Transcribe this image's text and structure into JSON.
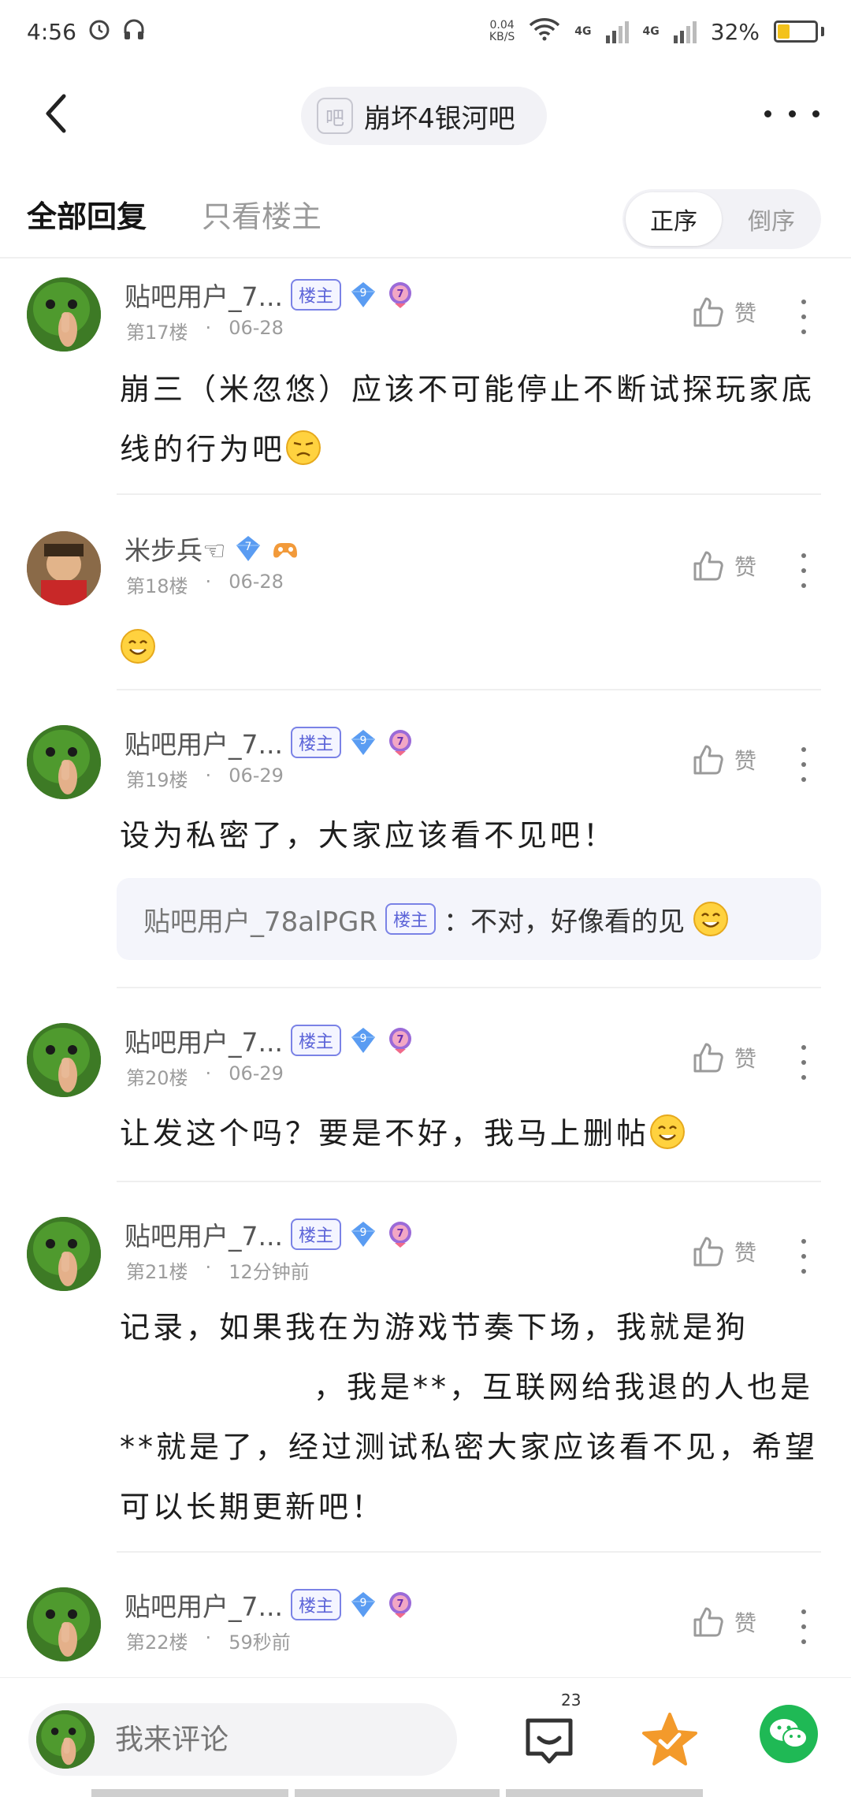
{
  "status_bar": {
    "time": "4:56",
    "net_speed_value": "0.04",
    "net_speed_unit": "KB/S",
    "sim1_label": "4G",
    "sim2_label": "4G",
    "battery_text": "32%",
    "battery_level": 0.32,
    "icons": [
      "alarm-icon",
      "headphones-icon",
      "wifi-icon",
      "signal-icon",
      "battery-icon"
    ]
  },
  "nav": {
    "forum_icon_text": "吧",
    "forum_name": "崩坏4银河吧"
  },
  "tabs": {
    "all_replies": "全部回复",
    "op_only": "只看楼主",
    "order_asc": "正序",
    "order_desc": "倒序"
  },
  "like_label": "赞",
  "op_badge": "楼主",
  "posts": [
    {
      "username": "贴吧用户_7...",
      "is_op": true,
      "level": "9",
      "floor": "第17楼",
      "time": "06-28",
      "content": "崩三（米忽悠）应该不可能停止不断试探玩家底线的行为吧"
    },
    {
      "username": "米步兵☜",
      "is_op": false,
      "level": "7",
      "floor": "第18楼",
      "time": "06-28",
      "content": ""
    },
    {
      "username": "贴吧用户_7...",
      "is_op": true,
      "level": "9",
      "floor": "第19楼",
      "time": "06-29",
      "content": "设为私密了，大家应该看不见吧！",
      "sub_reply": {
        "author": "贴吧用户_78alPGR",
        "text": "：不对，好像看的见"
      }
    },
    {
      "username": "贴吧用户_7...",
      "is_op": true,
      "level": "9",
      "floor": "第20楼",
      "time": "06-29",
      "content": "让发这个吗？要是不好，我马上删帖"
    },
    {
      "username": "贴吧用户_7...",
      "is_op": true,
      "level": "9",
      "floor": "第21楼",
      "time": "12分钟前",
      "content_line1": "记录，如果我在为游戏节奏下场，我就是狗",
      "content_line2": "，我是**，互联网给我退的人也是",
      "content_line3": "**就是了，经过测试私密大家应该看不见，希望",
      "content_line4": "可以长期更新吧！"
    },
    {
      "username": "贴吧用户_7...",
      "is_op": true,
      "level": "9",
      "floor": "第22楼",
      "time": "59秒前"
    }
  ],
  "bottom_bar": {
    "comment_placeholder": "我来评论",
    "reply_count": "23"
  },
  "colors": {
    "accent_purple": "#5b63d8",
    "level_blue": "#4a90f0",
    "star_orange": "#f39a2b",
    "wechat_green": "#1fb955"
  }
}
